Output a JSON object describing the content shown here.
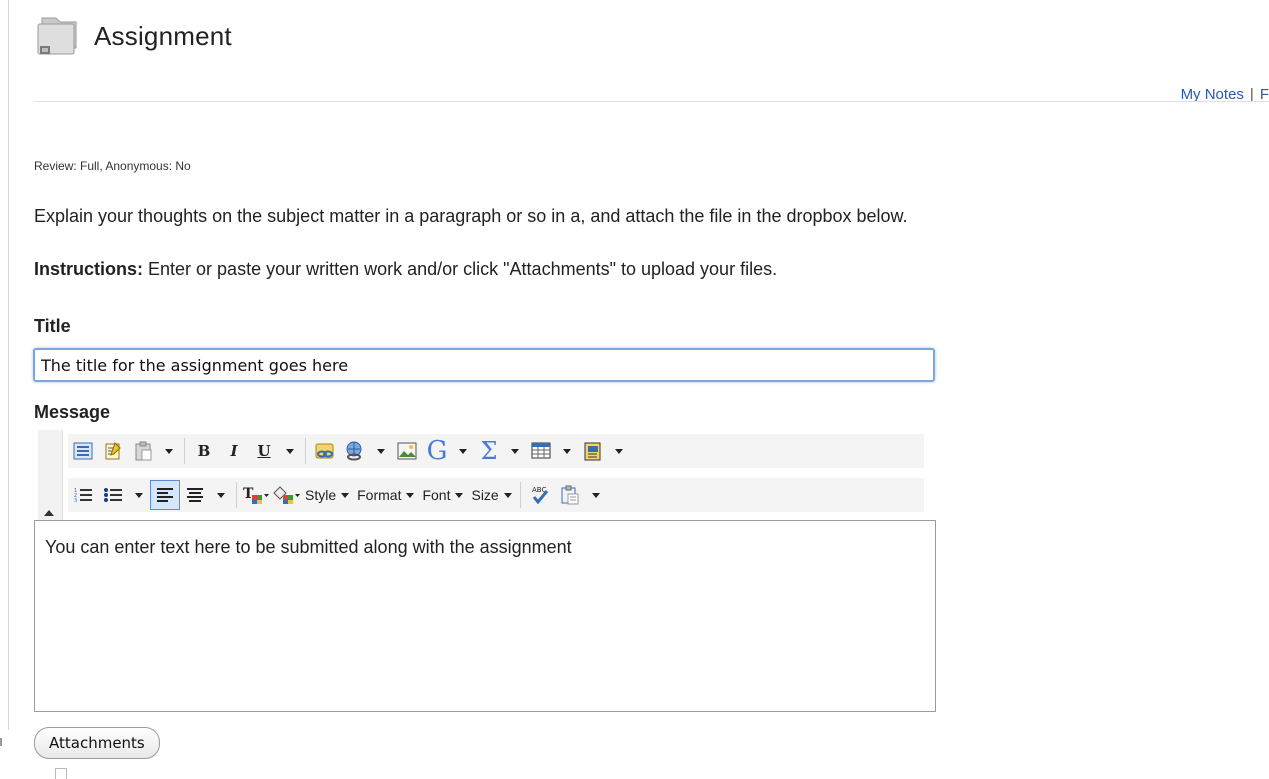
{
  "header": {
    "title": "Assignment"
  },
  "toplinks": {
    "my_notes": "My Notes",
    "separator": "|",
    "next": "F"
  },
  "meta": {
    "review_line": "Review: Full, Anonymous: No"
  },
  "assignment": {
    "description": "Explain your thoughts on the subject matter in a paragraph or so in a, and attach the file in the dropbox below.",
    "instructions_label": "Instructions:",
    "instructions_text": " Enter or paste your written work and/or click \"Attachments\" to upload your files."
  },
  "form": {
    "title_label": "Title",
    "title_value": "The title for the assignment goes here",
    "message_label": "Message",
    "message_body": "You can enter text here to be submitted along with the assignment",
    "attachments_label": "Attachments"
  },
  "toolbar": {
    "bold": "B",
    "italic": "I",
    "underline": "U",
    "google": "G",
    "sigma": "Σ",
    "style": "Style",
    "format": "Format",
    "font": "Font",
    "size": "Size",
    "spell": "ABC"
  },
  "colors": {
    "accent": "#2a5aa8",
    "focus_border": "#7fa6d6"
  }
}
